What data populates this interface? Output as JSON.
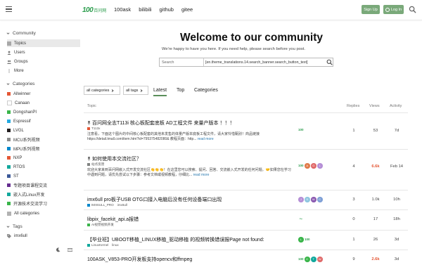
{
  "header": {
    "logo_mark": "100",
    "logo_text": "百问网",
    "links": [
      "100ask",
      "bilibili",
      "github",
      "gitee"
    ],
    "signup_label": "Sign Up",
    "login_label": "Log In"
  },
  "sidebar": {
    "community_label": "Community",
    "community_items": [
      "Topics",
      "Users",
      "Groups",
      "More"
    ],
    "categories_label": "Categories",
    "categories": [
      {
        "label": "Allwinner",
        "color": "#e45735"
      },
      {
        "label": "Canaan",
        "color": "#ffffff"
      },
      {
        "label": "DongshanPI",
        "color": "#3ab54a"
      },
      {
        "label": "Espressif",
        "color": "#25aae1"
      },
      {
        "label": "LVGL",
        "color": "#231f20"
      },
      {
        "label": "MCU系列视频",
        "color": "#8b8b8b"
      },
      {
        "label": "MPU系列视频",
        "color": "#0088cc"
      },
      {
        "label": "NXP",
        "color": "#e45735"
      },
      {
        "label": "RTOS",
        "color": "#12a89d"
      },
      {
        "label": "ST",
        "color": "#3b5998"
      },
      {
        "label": "专题项目课程交流",
        "color": "#652d90"
      },
      {
        "label": "嵌入式Linux开发",
        "color": "#12a89d"
      },
      {
        "label": "开源技术交流学习",
        "color": "#3ab54a"
      }
    ],
    "all_categories": "All categories",
    "tags_label": "Tags",
    "tags": [
      "imx6ull"
    ]
  },
  "hero": {
    "title": "Welcome to our community",
    "subtitle": "We're happy to have you here. If you need help, please search before you post.",
    "search_placeholder": "Search",
    "search_option": "[en.theme_translations.14.search_banner.search_button_text]"
  },
  "filters": {
    "categories_dd": "all categories",
    "tags_dd": "all tags",
    "tabs": [
      "Latest",
      "Top",
      "Categories"
    ]
  },
  "table": {
    "headers": {
      "topic": "Topic",
      "replies": "Replies",
      "views": "Views",
      "activity": "Activity"
    },
    "rows": [
      {
        "title": "百问网全志T113i 核心板配套底板 AD工程文件 来量产版本 ！！！",
        "pinned": true,
        "category": "T113x",
        "cat_color": "#e45735",
        "excerpt": "注意看，下面这个图片的中间核心板配套的其他未发售的体量产版本底板工程文件，请大家怜惜甄别！商品链接 https://detail.tmall.com/item.htm?id=795375482080& 教程页面：http...",
        "read_more": "read more",
        "avatars": [
          {
            "t": "100",
            "c": "#ffffff",
            "fg": "#2e9e4f"
          }
        ],
        "replies": "1",
        "views": "53",
        "views_hot": false,
        "activity": "7d"
      },
      {
        "title": "如何使用本交流社区？",
        "pinned": true,
        "category": "站点反馈",
        "cat_color": "#808281",
        "excerpt": "欢迎大家来到百问网嵌入式开发交流社区👏👏👏！在这里您可以搜索、提问、回答、交流嵌入式开发的任何问题。🤝如果您在学习中遇到问题，请优先尝试以下步骤：参考文档或视频教程，仔细比...",
        "read_more": "read more",
        "avatars": [
          {
            "t": "100",
            "c": "#ffffff",
            "fg": "#2e9e4f"
          },
          {
            "t": "A",
            "c": "#e07b4a",
            "fg": "#fff"
          },
          {
            "t": "G",
            "c": "#e06a6a",
            "fg": "#fff"
          },
          {
            "t": "L",
            "c": "#b58fd6",
            "fg": "#fff"
          }
        ],
        "replies": "4",
        "views": "6.6k",
        "views_hot": true,
        "activity": "Feb 14"
      },
      {
        "title": "imx6ull pro板子USB OTG口接入电脑后没有任何设备端口出现",
        "pinned": false,
        "category": "IMX6ULL_PRO",
        "cat_color": "#0088cc",
        "tag": "imx6ull",
        "excerpt": "",
        "read_more": "",
        "avatars": [
          {
            "t": "J",
            "c": "#b58fd6",
            "fg": "#fff"
          },
          {
            "t": "S",
            "c": "#8fc6e0",
            "fg": "#fff"
          },
          {
            "t": "W",
            "c": "#8b5ab0",
            "fg": "#fff"
          },
          {
            "t": "C",
            "c": "#7fa0d6",
            "fg": "#fff"
          }
        ],
        "replies": "3",
        "views": "1.0k",
        "views_hot": false,
        "activity": "10h"
      },
      {
        "title": "libpix_facekit_api.a报错",
        "pinned": false,
        "category": "AI视觉视频开发",
        "cat_color": "#3ab54a",
        "excerpt": "",
        "read_more": "",
        "avatars": [
          {
            "t": "～",
            "c": "#ffffff",
            "fg": "#2e9e4f"
          }
        ],
        "replies": "0",
        "views": "17",
        "views_hot": false,
        "activity": "18h"
      },
      {
        "title": "【毕业班】UBOOT移植_LINUX移植_驱动移植 的视频转换错误报Page not found:",
        "pinned": false,
        "category": "LinuxKernel",
        "cat_color": "#12a89d",
        "tag": "linux",
        "excerpt": "",
        "read_more": "",
        "avatars": [
          {
            "t": "L",
            "c": "#3ab54a",
            "fg": "#fff"
          },
          {
            "t": "100",
            "c": "#ffffff",
            "fg": "#2e9e4f"
          }
        ],
        "replies": "1",
        "views": "26",
        "views_hot": false,
        "activity": "3d"
      },
      {
        "title": "100ASK_V853-PRO开发板支持opencv和ffmpeg",
        "pinned": false,
        "category": "",
        "cat_color": "#e45735",
        "excerpt": "",
        "read_more": "",
        "avatars": [
          {
            "t": "100",
            "c": "#ffffff",
            "fg": "#2e9e4f"
          },
          {
            "t": "C",
            "c": "#3ab54a",
            "fg": "#fff"
          },
          {
            "t": "T",
            "c": "#12a89d",
            "fg": "#fff"
          },
          {
            "t": "W",
            "c": "#e06a6a",
            "fg": "#fff"
          }
        ],
        "replies": "9",
        "views": "2.6k",
        "views_hot": true,
        "activity": "3d"
      }
    ]
  }
}
